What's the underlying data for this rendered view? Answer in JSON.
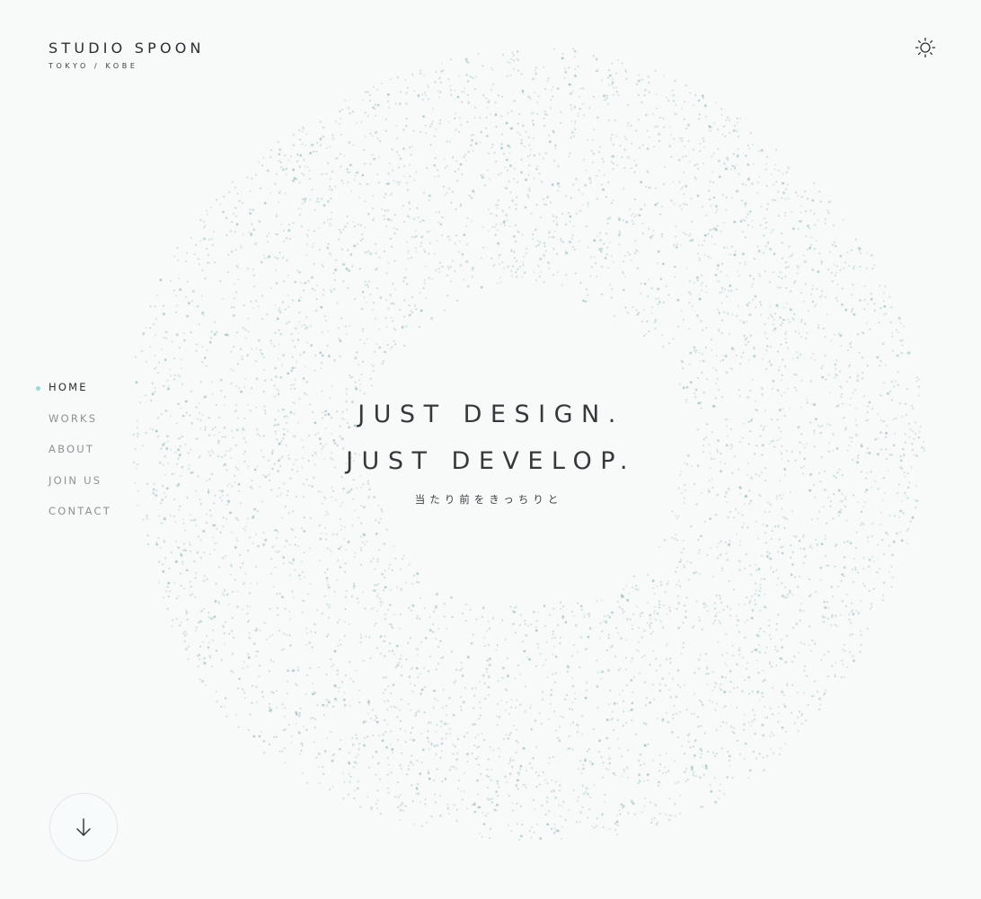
{
  "brand": {
    "title": "STUDIO SPOON",
    "subtitle": "TOKYO / KOBE"
  },
  "theme_toggle": {
    "icon": "sun-icon"
  },
  "nav": {
    "items": [
      {
        "label": "HOME",
        "active": true
      },
      {
        "label": "WORKS",
        "active": false
      },
      {
        "label": "ABOUT",
        "active": false
      },
      {
        "label": "JOIN US",
        "active": false
      },
      {
        "label": "CONTACT",
        "active": false
      }
    ]
  },
  "hero": {
    "line1": "JUST DESIGN.",
    "line2": "JUST DEVELOP.",
    "tagline": "当たり前をきっちりと"
  },
  "scroll_button": {
    "icon": "arrow-down-icon"
  },
  "colors": {
    "background": "#f8fafa",
    "particle": "#8fb5b3",
    "accent_dot": "#9fd6da",
    "text_dark": "#2a2e30",
    "text_muted": "#8c9294"
  }
}
